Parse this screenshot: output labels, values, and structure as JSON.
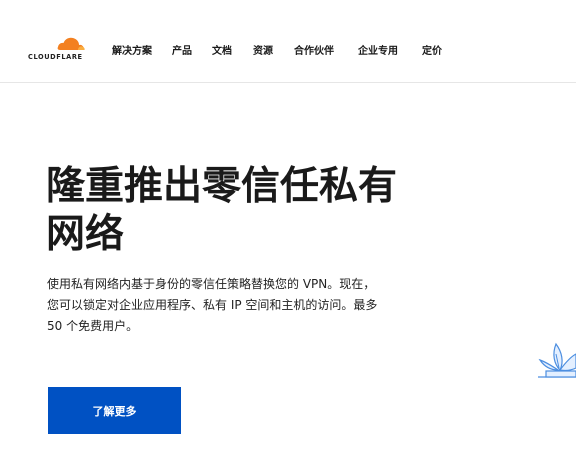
{
  "header": {
    "logo_text": "CLOUDFLARE",
    "nav": [
      {
        "label": "解决方案"
      },
      {
        "label": "产品"
      },
      {
        "label": "文档"
      },
      {
        "label": "资源"
      },
      {
        "label": "合作伙伴"
      },
      {
        "label": "企业专用"
      },
      {
        "label": "定价"
      }
    ]
  },
  "hero": {
    "headline_lines": [
      "隆重推出零信任私有",
      "网络"
    ],
    "description_lines": [
      "使用私有网络内基于身份的零信任策略替换您的 VPN。现在，",
      "您可以锁定对企业应用程序、私有 IP 空间和主机的访问。最多",
      "50 个免费用户。"
    ],
    "cta_label": "了解更多"
  },
  "colors": {
    "brand_orange": "#f38020",
    "cta_blue": "#0051c3",
    "illustration_blue": "#4c8ee0"
  },
  "icons": {
    "logo": "cloudflare-cloud-logo",
    "illustration": "plant-leaves-illustration"
  }
}
